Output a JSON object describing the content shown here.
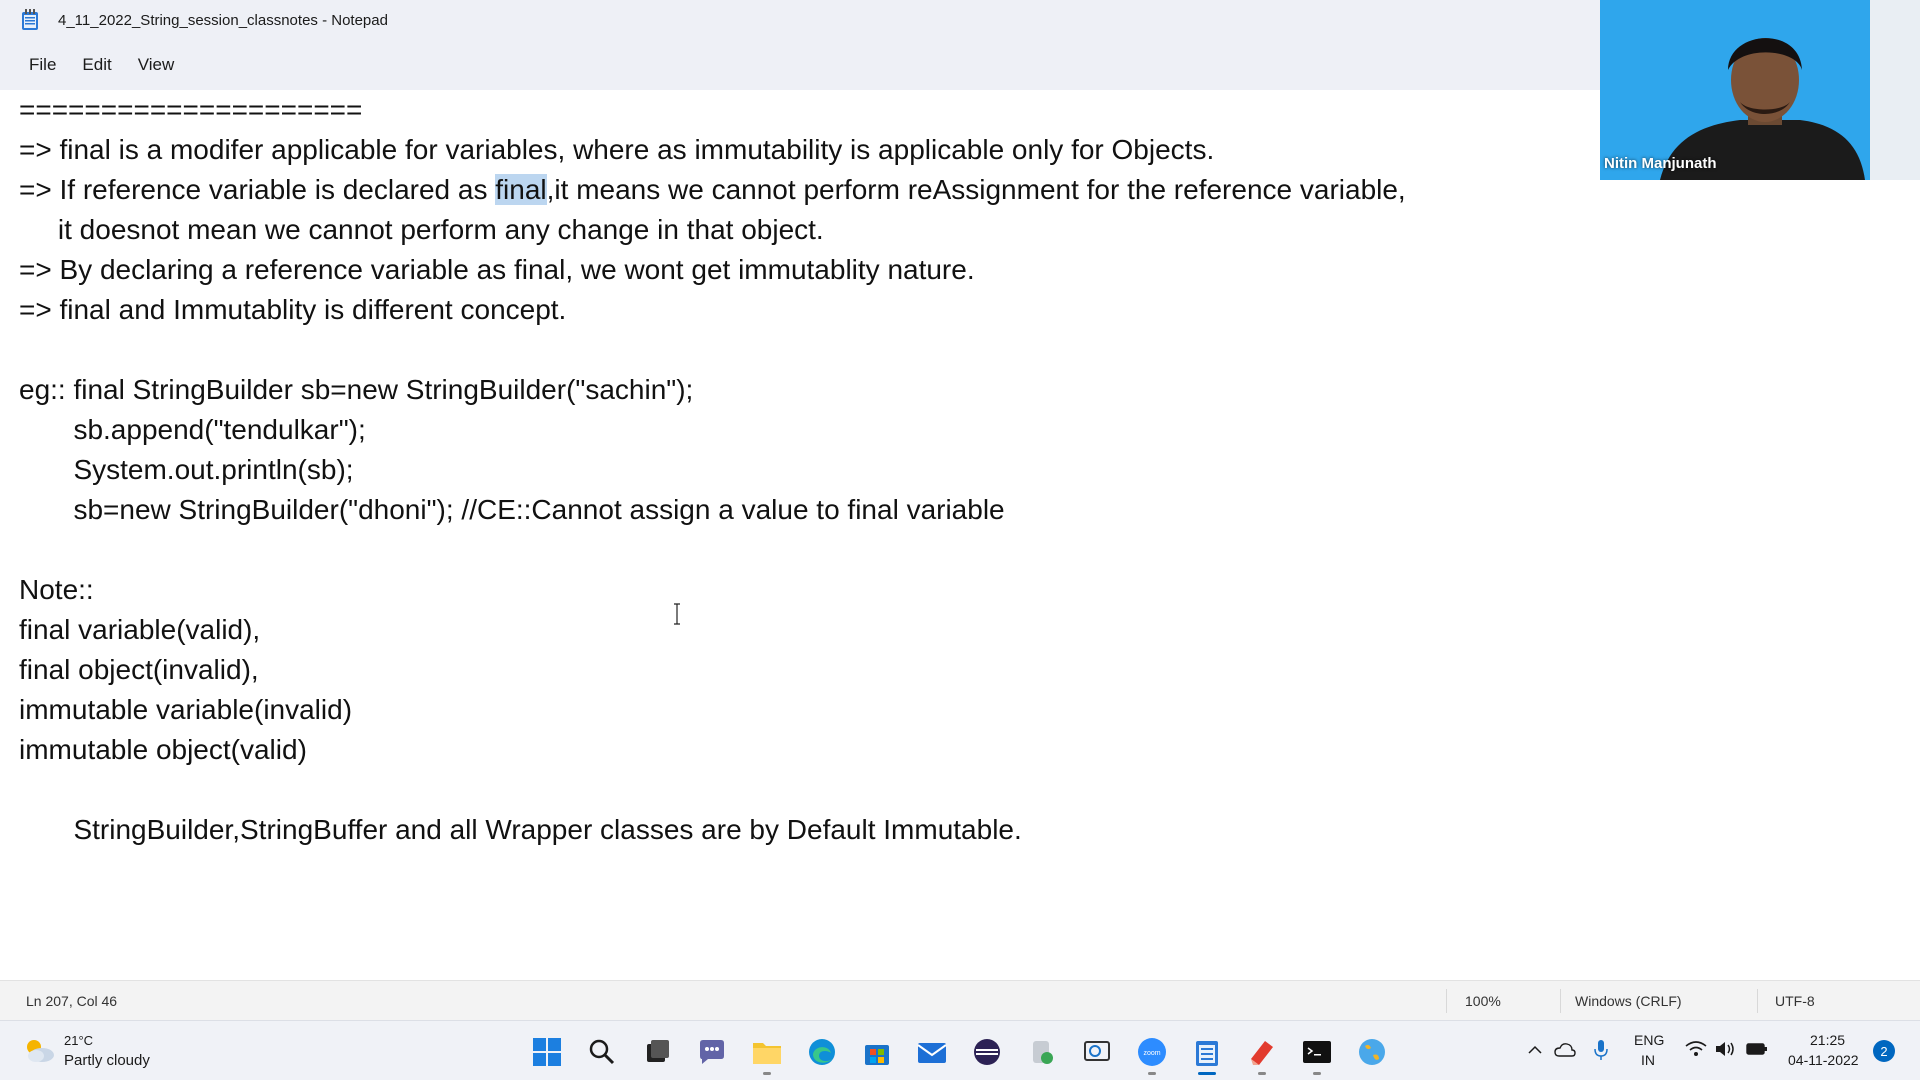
{
  "window": {
    "title": "4_11_2022_String_session_classnotes - Notepad"
  },
  "menu": {
    "items": [
      "File",
      "Edit",
      "View"
    ]
  },
  "editor": {
    "lines": [
      "=====================",
      "=> final is a modifer applicable for variables, where as immutability is applicable only for Objects.",
      "=> If reference variable is declared as ",
      "final",
      ",it means we cannot perform reAssignment for the reference variable,",
      "     it doesnot mean we cannot perform any change in that object.",
      "=> By declaring a reference variable as final, we wont get immutablity nature.",
      "=> final and Immutablity is different concept.",
      "eg:: final StringBuilder sb=new StringBuilder(\"sachin\");",
      "       sb.append(\"tendulkar\");",
      "       System.out.println(sb);",
      "       sb=new StringBuilder(\"dhoni\"); //CE::Cannot assign a value to final variable",
      "Note::",
      "final variable(valid),",
      "final object(invalid),",
      "immutable variable(invalid)",
      "immutable object(valid)",
      "       StringBuilder,StringBuffer and all Wrapper classes are by Default Immutable."
    ]
  },
  "video": {
    "participant_name": "Nitin Manjunath"
  },
  "statusbar": {
    "position": "Ln 207, Col 46",
    "zoom": "100%",
    "line_ending": "Windows (CRLF)",
    "encoding": "UTF-8"
  },
  "taskbar": {
    "weather_temp": "21°C",
    "weather_desc": "Partly cloudy",
    "language_top": "ENG",
    "language_bottom": "IN",
    "time": "21:25",
    "date": "04-11-2022",
    "notification_count": "2",
    "apps": [
      "start-icon",
      "search-icon",
      "task-view-icon",
      "chat-icon",
      "file-explorer-icon",
      "edge-icon",
      "store-icon",
      "mail-icon",
      "eclipse-icon",
      "app-icon",
      "snipping-icon",
      "zoom-icon",
      "notepad-icon",
      "pdf-icon",
      "terminal-icon",
      "globe-icon"
    ]
  },
  "colors": {
    "selection": "#bcd6f0",
    "chrome": "#eef0f6",
    "accent": "#0067c0"
  }
}
